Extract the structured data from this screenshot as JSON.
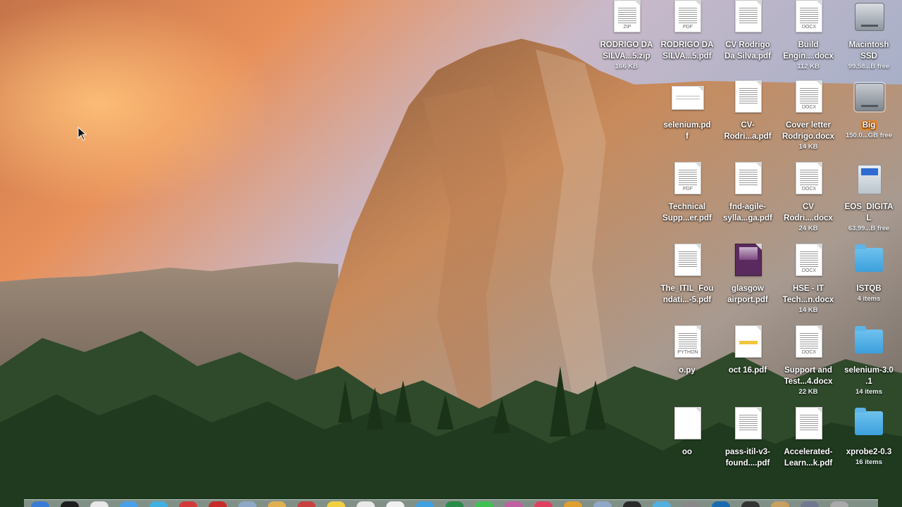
{
  "colors": {
    "folder": "#4aaee6",
    "badge": "#e8872a",
    "label": "#ffffff"
  },
  "desktop": {
    "icons": [
      {
        "name": "RODRIGO DA\nSILVA...5.zip",
        "sub": "166 KB",
        "icon": "zip-file-icon",
        "tag": "ZIP"
      },
      {
        "name": "RODRIGO DA\nSILVA...5.pdf",
        "sub": "",
        "icon": "pdf-file-icon",
        "tag": "PDF"
      },
      {
        "name": "CV Rodrigo\nDa Silva.pdf",
        "sub": "",
        "icon": "pdf-file-icon",
        "tag": ""
      },
      {
        "name": "Build\nEngin....docx",
        "sub": "112 KB",
        "icon": "docx-file-icon",
        "tag": "DOCX"
      },
      {
        "name": "Macintosh\nSSD",
        "sub": "99.58...B free",
        "icon": "hard-drive-icon",
        "tag": ""
      },
      {
        "name": "selenium.pd\nf",
        "sub": "",
        "icon": "pdf-file-icon",
        "tag": ""
      },
      {
        "name": "CV-\nRodri...a.pdf",
        "sub": "",
        "icon": "pdf-file-icon",
        "tag": ""
      },
      {
        "name": "Cover letter\nRodrigo.docx",
        "sub": "14 KB",
        "icon": "docx-file-icon",
        "tag": "DOCX"
      },
      {
        "name": "Big",
        "sub": "150.0...GB free",
        "icon": "hard-drive-icon",
        "tag": ""
      },
      {
        "name": "Technical\nSupp...er.pdf",
        "sub": "",
        "icon": "pdf-file-icon",
        "tag": "PDF"
      },
      {
        "name": "fnd-agile-\nsylla...ga.pdf",
        "sub": "",
        "icon": "pdf-file-icon",
        "tag": ""
      },
      {
        "name": "CV\nRodri....docx",
        "sub": "24 KB",
        "icon": "docx-file-icon",
        "tag": "DOCX"
      },
      {
        "name": "EOS_DIGITA\nL",
        "sub": "63.99...B free",
        "icon": "sd-card-icon",
        "tag": ""
      },
      {
        "name": "The_ITIL_Fou\nndati...-5.pdf",
        "sub": "",
        "icon": "pdf-file-icon",
        "tag": ""
      },
      {
        "name": "glasgow\nairport.pdf",
        "sub": "",
        "icon": "pdf-file-icon",
        "tag": ""
      },
      {
        "name": "HSE - IT\nTech...n.docx",
        "sub": "14 KB",
        "icon": "docx-file-icon",
        "tag": "DOCX"
      },
      {
        "name": "ISTQB",
        "sub": "4 items",
        "icon": "folder-icon",
        "tag": ""
      },
      {
        "name": "o.py",
        "sub": "",
        "icon": "python-file-icon",
        "tag": "PYTHON"
      },
      {
        "name": "oct 16.pdf",
        "sub": "",
        "icon": "pdf-file-icon",
        "tag": ""
      },
      {
        "name": "Support and\nTest...4.docx",
        "sub": "22 KB",
        "icon": "docx-file-icon",
        "tag": "DOCX"
      },
      {
        "name": "selenium-3.0\n.1",
        "sub": "14 items",
        "icon": "folder-icon",
        "tag": ""
      },
      {
        "name": "oo",
        "sub": "",
        "icon": "blank-file-icon",
        "tag": ""
      },
      {
        "name": "pass-itil-v3-\nfound....pdf",
        "sub": "",
        "icon": "pdf-file-icon",
        "tag": ""
      },
      {
        "name": "Accelerated-\nLearn...k.pdf",
        "sub": "",
        "icon": "pdf-file-icon",
        "tag": ""
      },
      {
        "name": "xprobe2-0.3",
        "sub": "16 items",
        "icon": "folder-icon",
        "tag": ""
      }
    ]
  }
}
